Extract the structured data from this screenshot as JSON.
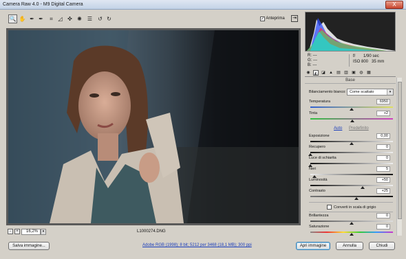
{
  "window": {
    "title": "Camera Raw 4.0  -  M9 Digital Camera",
    "close_label": "X"
  },
  "toolbar": {
    "tools": [
      {
        "name": "zoom-tool",
        "glyph": "🔍"
      },
      {
        "name": "hand-tool",
        "glyph": "✋"
      },
      {
        "name": "white-balance-tool",
        "glyph": "✒"
      },
      {
        "name": "color-sampler-tool",
        "glyph": "✒"
      },
      {
        "name": "crop-tool",
        "glyph": "⌗"
      },
      {
        "name": "straighten-tool",
        "glyph": "◿"
      },
      {
        "name": "retouch-tool",
        "glyph": "✜"
      },
      {
        "name": "red-eye-tool",
        "glyph": "✺"
      },
      {
        "name": "preferences-tool",
        "glyph": "☰"
      },
      {
        "name": "rotate-left-tool",
        "glyph": "↺"
      },
      {
        "name": "rotate-right-tool",
        "glyph": "↻"
      }
    ],
    "preview_label": "Anteprima",
    "preview_checked": "✓",
    "fullscreen_glyph": "⇥"
  },
  "image_status": {
    "zoom_out": "-",
    "zoom_in": "+",
    "zoom": "16,2%",
    "zoom_dropdown": "▾",
    "filename": "L1000274.DNG"
  },
  "info": {
    "r": "R:   ---",
    "g": "G:   ---",
    "b": "B:   ---",
    "f": "f/",
    "shutter": "1/90 sec",
    "iso": "ISO 800",
    "focal": "35 mm"
  },
  "panel": {
    "header": "Base",
    "wb_label": "Bilanciamento bianco:",
    "wb_value": "Come scattato",
    "wb_arrow": "▾",
    "temperature": {
      "label": "Temperatura",
      "value": "6950",
      "level": 0.5
    },
    "tint": {
      "label": "Tinta",
      "value": "+2",
      "level": 0.51
    },
    "auto_link": "Auto",
    "default_link": "Predefinito",
    "exposure": {
      "label": "Esposizione",
      "value": "0,00",
      "level": 0.5
    },
    "recovery": {
      "label": "Recupero",
      "value": "0",
      "level": 0
    },
    "fill": {
      "label": "Luce di schiarita",
      "value": "0",
      "level": 0
    },
    "blacks": {
      "label": "Neri",
      "value": "5",
      "level": 0.05
    },
    "brightness": {
      "label": "Luminosità",
      "value": "+50",
      "level": 0.63
    },
    "contrast": {
      "label": "Contrasto",
      "value": "+25",
      "level": 0.56
    },
    "grayscale_label": "Converti in scala di grigio",
    "clarity": {
      "label": "Brillantezza",
      "value": "0",
      "level": 0.5
    },
    "saturation": {
      "label": "Saturazione",
      "value": "0",
      "level": 0.5
    }
  },
  "bottom": {
    "save": "Salva immagine...",
    "workflow": "Adobe RGB (1998); 8 bit; 5212 per 3468 (18,1 MB); 300 ppi",
    "open": "Apri immagine",
    "cancel": "Annulla",
    "close": "Chiudi"
  },
  "colors": {
    "accent_link": "#1a3dbb",
    "histogram_bg": "#222222",
    "default_button_border": "#3c7fb1"
  }
}
